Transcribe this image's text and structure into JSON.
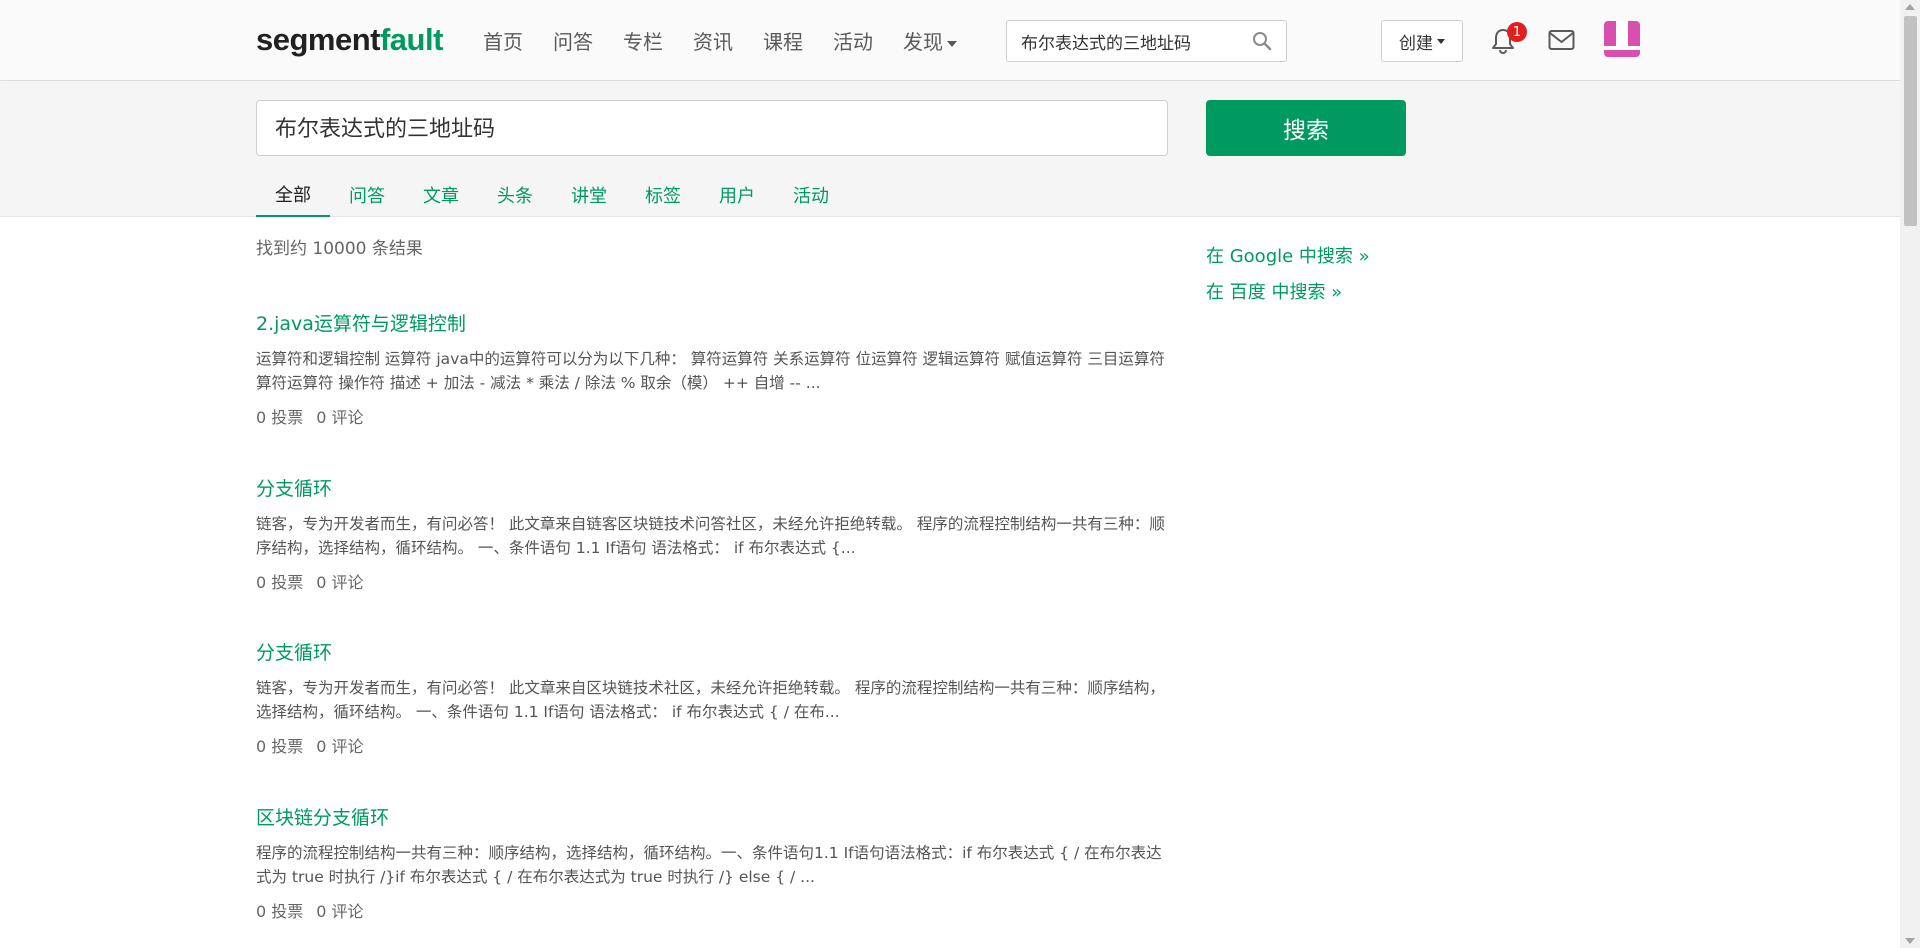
{
  "navbar": {
    "logo_main": "segment",
    "logo_accent": "fault",
    "nav_items": [
      "首页",
      "问答",
      "专栏",
      "资讯",
      "课程",
      "活动"
    ],
    "discover_label": "发现",
    "search_value": "布尔表达式的三地址码",
    "create_label": "创建",
    "notification_count": "1",
    "icons": {
      "search": "search-icon",
      "bell": "bell-icon",
      "mail": "mail-icon",
      "avatar": "avatar"
    }
  },
  "search": {
    "query": "布尔表达式的三地址码",
    "button_label": "搜索"
  },
  "tabs": [
    {
      "label": "全部",
      "active": true
    },
    {
      "label": "问答",
      "active": false
    },
    {
      "label": "文章",
      "active": false
    },
    {
      "label": "头条",
      "active": false
    },
    {
      "label": "讲堂",
      "active": false
    },
    {
      "label": "标签",
      "active": false
    },
    {
      "label": "用户",
      "active": false
    },
    {
      "label": "活动",
      "active": false
    }
  ],
  "results_count": "找到约 10000 条结果",
  "results": [
    {
      "title": "2.java运算符与逻辑控制",
      "snippet": "运算符和逻辑控制 运算符 java中的运算符可以分为以下几种： 算符运算符 关系运算符 位运算符 逻辑运算符 赋值运算符 三目运算符 算符运算符 操作符 描述 + 加法 - 减法 * 乘法 / 除法 % 取余（模） ++ 自增 -- ...",
      "votes": "0 投票",
      "comments": "0 评论"
    },
    {
      "title": "分支循环",
      "snippet": "链客，专为开发者而生，有问必答！ 此文章来自链客区块链技术问答社区，未经允许拒绝转载。 程序的流程控制结构一共有三种：顺序结构，选择结构，循环结构。 一、条件语句 1.1 If语句 语法格式： if 布尔表达式 {...",
      "votes": "0 投票",
      "comments": "0 评论"
    },
    {
      "title": "分支循环",
      "snippet": "链客，专为开发者而生，有问必答！ 此文章来自区块链技术社区，未经允许拒绝转载。 程序的流程控制结构一共有三种：顺序结构，选择结构，循环结构。 一、条件语句 1.1 If语句 语法格式： if 布尔表达式 { / 在布...",
      "votes": "0 投票",
      "comments": "0 评论"
    },
    {
      "title": "区块链分支循环",
      "snippet": " 程序的流程控制结构一共有三种：顺序结构，选择结构，循环结构。一、条件语句1.1 If语句语法格式：if 布尔表达式 { / 在布尔表达式为 true 时执行 /}if 布尔表达式 { / 在布尔表达式为 true 时执行 /} else { / ...",
      "votes": "0 投票",
      "comments": "0 评论"
    }
  ],
  "sidebar": {
    "google_link": "在 Google 中搜索 »",
    "baidu_link": "在 百度 中搜索 »"
  },
  "colors": {
    "accent": "#009a61",
    "badge": "#e02020",
    "avatar": "#d94fb0"
  }
}
